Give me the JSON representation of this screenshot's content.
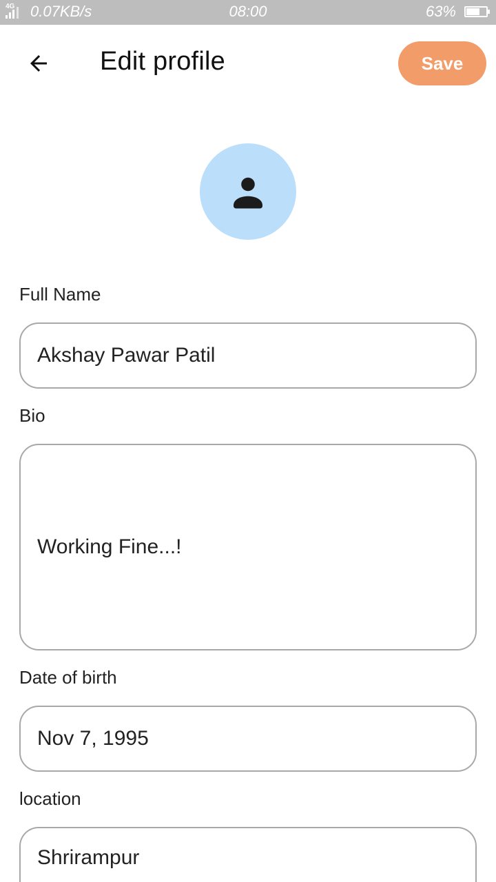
{
  "status_bar": {
    "network": "4G",
    "speed": "0.07KB/s",
    "time": "08:00",
    "battery": "63%",
    "battery_level": 0.63
  },
  "app_bar": {
    "back_icon": "arrow-back-icon",
    "title": "Edit profile",
    "save_label": "Save"
  },
  "avatar": {
    "icon": "person-icon",
    "background": "#bbdefb"
  },
  "form": {
    "full_name": {
      "label": "Full Name",
      "value": "Akshay Pawar Patil"
    },
    "bio": {
      "label": "Bio",
      "value": "Working Fine...!"
    },
    "dob": {
      "label": "Date of birth",
      "value": "Nov 7, 1995"
    },
    "location": {
      "label": "location",
      "value": "Shrirampur"
    }
  },
  "colors": {
    "accent": "#f29c69",
    "status_bar": "#bdbdbd",
    "field_border": "#a8a8a8"
  }
}
